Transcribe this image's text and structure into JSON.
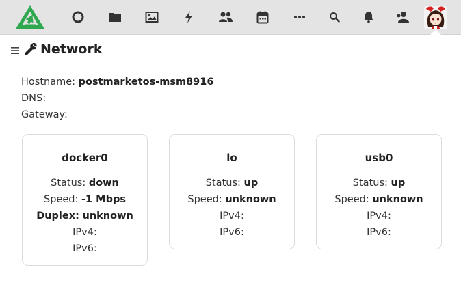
{
  "topbar": {
    "logo": "app-logo",
    "icons": [
      "circle-icon",
      "folder-icon",
      "image-icon",
      "lightning-icon",
      "users-icon",
      "calendar-icon",
      "more-icon",
      "search-icon",
      "bell-icon",
      "user-icon"
    ],
    "background": "#e4e4e4",
    "logo_color": "#2fa84f"
  },
  "page": {
    "title": "Network"
  },
  "info": {
    "hostname_label": "Hostname:",
    "hostname_value": "postmarketos-msm8916",
    "dns_label": "DNS:",
    "dns_value": "",
    "gateway_label": "Gateway:",
    "gateway_value": ""
  },
  "interfaces": [
    {
      "name": "docker0",
      "status_label": "Status:",
      "status": "down",
      "speed_label": "Speed:",
      "speed": "-1 Mbps",
      "duplex_label": "Duplex:",
      "duplex": "unknown",
      "ipv4_label": "IPv4:",
      "ipv4": "",
      "ipv6_label": "IPv6:",
      "ipv6": ""
    },
    {
      "name": "lo",
      "status_label": "Status:",
      "status": "up",
      "speed_label": "Speed:",
      "speed": "unknown",
      "ipv4_label": "IPv4:",
      "ipv4": "",
      "ipv6_label": "IPv6:",
      "ipv6": ""
    },
    {
      "name": "usb0",
      "status_label": "Status:",
      "status": "up",
      "speed_label": "Speed:",
      "speed": "unknown",
      "ipv4_label": "IPv4:",
      "ipv4": "",
      "ipv6_label": "IPv6:",
      "ipv6": ""
    }
  ]
}
